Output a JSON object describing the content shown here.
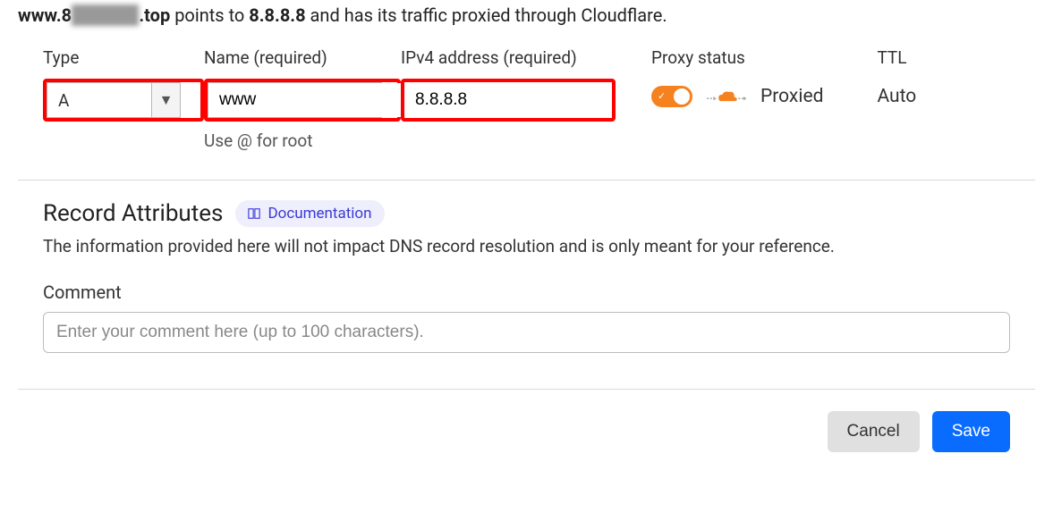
{
  "summary": {
    "prefix": "www.8",
    "blurred": "xxxxxxx",
    "suffix": ".top",
    "mid": " points to ",
    "ip": "8.8.8.8",
    "tail": " and has its traffic proxied through Cloudflare."
  },
  "labels": {
    "type": "Type",
    "name": "Name (required)",
    "ip": "IPv4 address (required)",
    "proxy": "Proxy status",
    "ttl": "TTL"
  },
  "values": {
    "type": "A",
    "name": "www",
    "ip": "8.8.8.8",
    "name_hint": "Use @ for root",
    "proxy_label": "Proxied",
    "ttl": "Auto"
  },
  "attrs": {
    "title": "Record Attributes",
    "doc": "Documentation",
    "desc": "The information provided here will not impact DNS record resolution and is only meant for your reference.",
    "comment_label": "Comment",
    "comment_placeholder": "Enter your comment here (up to 100 characters)."
  },
  "actions": {
    "cancel": "Cancel",
    "save": "Save"
  }
}
